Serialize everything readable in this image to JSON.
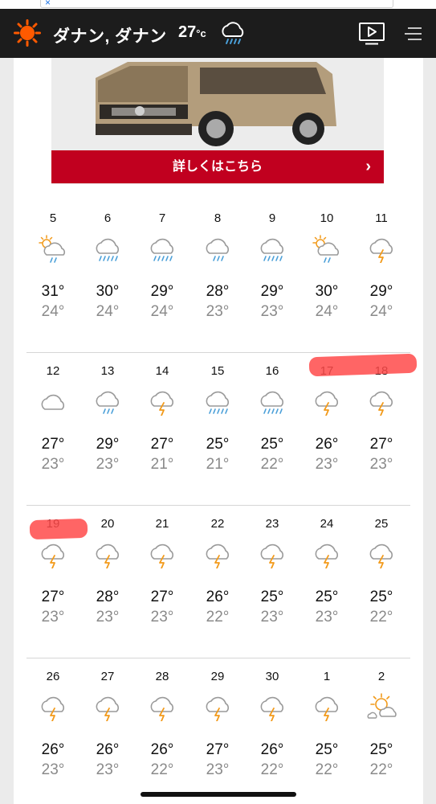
{
  "header": {
    "location": "ダナン, ダナン",
    "temp": "27",
    "temp_unit": "°c"
  },
  "ad": {
    "button_label": "詳しくはこちら",
    "chevron": "›"
  },
  "weeks": [
    [
      {
        "date": "5",
        "hi": "31°",
        "lo": "24°",
        "icon": "sun-cloud-rain-icon"
      },
      {
        "date": "6",
        "hi": "30°",
        "lo": "24°",
        "icon": "cloud-heavy-rain-icon"
      },
      {
        "date": "7",
        "hi": "29°",
        "lo": "24°",
        "icon": "cloud-heavy-rain-icon"
      },
      {
        "date": "8",
        "hi": "28°",
        "lo": "23°",
        "icon": "cloud-rain-icon"
      },
      {
        "date": "9",
        "hi": "29°",
        "lo": "23°",
        "icon": "cloud-heavy-rain-icon"
      },
      {
        "date": "10",
        "hi": "30°",
        "lo": "24°",
        "icon": "sun-cloud-rain-icon"
      },
      {
        "date": "11",
        "hi": "29°",
        "lo": "24°",
        "icon": "thunder-cloud-icon"
      }
    ],
    [
      {
        "date": "12",
        "hi": "27°",
        "lo": "23°",
        "icon": "cloud-icon"
      },
      {
        "date": "13",
        "hi": "29°",
        "lo": "23°",
        "icon": "cloud-rain-icon"
      },
      {
        "date": "14",
        "hi": "27°",
        "lo": "21°",
        "icon": "thunder-cloud-icon"
      },
      {
        "date": "15",
        "hi": "25°",
        "lo": "21°",
        "icon": "cloud-heavy-rain-icon"
      },
      {
        "date": "16",
        "hi": "25°",
        "lo": "22°",
        "icon": "cloud-heavy-rain-icon"
      },
      {
        "date": "17",
        "hi": "26°",
        "lo": "23°",
        "icon": "thunder-cloud-icon"
      },
      {
        "date": "18",
        "hi": "27°",
        "lo": "23°",
        "icon": "thunder-cloud-icon"
      }
    ],
    [
      {
        "date": "19",
        "hi": "27°",
        "lo": "23°",
        "icon": "thunder-cloud-icon"
      },
      {
        "date": "20",
        "hi": "28°",
        "lo": "23°",
        "icon": "thunder-cloud-icon"
      },
      {
        "date": "21",
        "hi": "27°",
        "lo": "23°",
        "icon": "thunder-cloud-icon"
      },
      {
        "date": "22",
        "hi": "26°",
        "lo": "22°",
        "icon": "thunder-cloud-icon"
      },
      {
        "date": "23",
        "hi": "25°",
        "lo": "23°",
        "icon": "thunder-cloud-icon"
      },
      {
        "date": "24",
        "hi": "25°",
        "lo": "23°",
        "icon": "thunder-cloud-icon"
      },
      {
        "date": "25",
        "hi": "25°",
        "lo": "22°",
        "icon": "thunder-cloud-icon"
      }
    ],
    [
      {
        "date": "26",
        "hi": "26°",
        "lo": "23°",
        "icon": "thunder-cloud-icon"
      },
      {
        "date": "27",
        "hi": "26°",
        "lo": "23°",
        "icon": "thunder-cloud-icon"
      },
      {
        "date": "28",
        "hi": "26°",
        "lo": "22°",
        "icon": "thunder-cloud-icon"
      },
      {
        "date": "29",
        "hi": "27°",
        "lo": "23°",
        "icon": "thunder-cloud-icon"
      },
      {
        "date": "30",
        "hi": "26°",
        "lo": "22°",
        "icon": "thunder-cloud-icon"
      },
      {
        "date": "1",
        "hi": "25°",
        "lo": "22°",
        "icon": "thunder-cloud-icon"
      },
      {
        "date": "2",
        "hi": "25°",
        "lo": "22°",
        "icon": "sun-cloud-icon"
      }
    ]
  ],
  "colors": {
    "header_bg": "#1c1c1c",
    "sun_orange": "#ff5a00",
    "rain_blue": "#4a9fd8",
    "bolt_orange": "#f29a1a",
    "cloud_gray": "#9a9a9a",
    "ad_red": "#c1001f",
    "highlight": "#ff4a4a"
  }
}
